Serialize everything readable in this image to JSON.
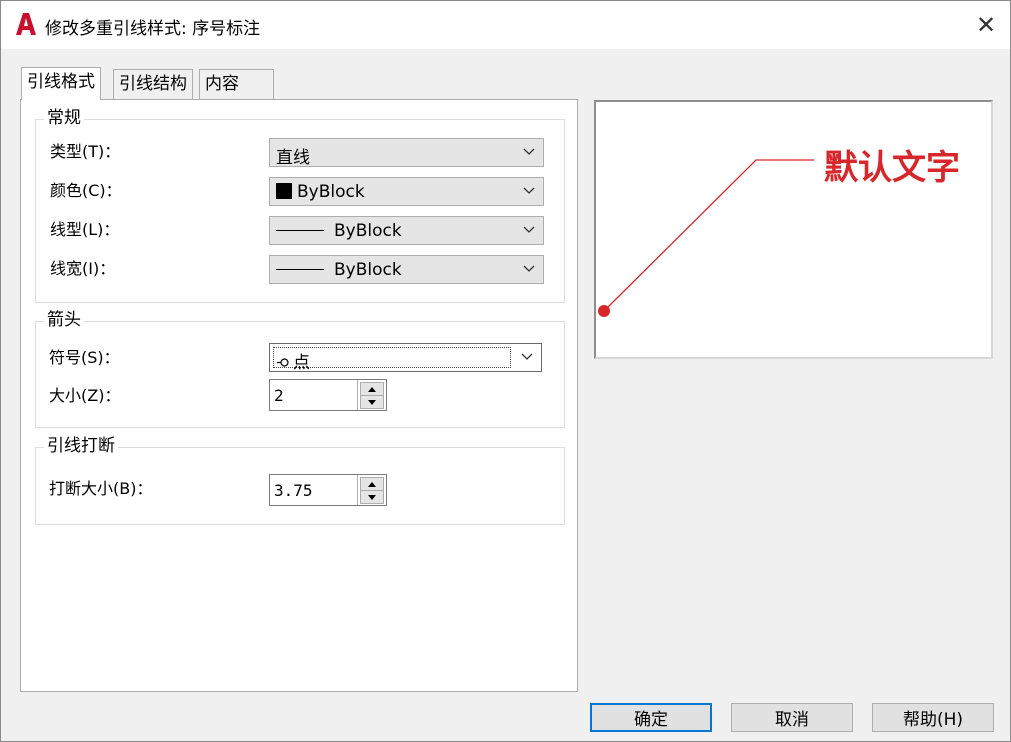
{
  "title": "修改多重引线样式: 序号标注",
  "colors": {
    "accent": "#0078d7",
    "preview_red": "#d9262b",
    "logo_red": "#c8102e"
  },
  "tabs": [
    {
      "label": "引线格式",
      "active": true
    },
    {
      "label": "引线结构",
      "active": false
    },
    {
      "label": "内容",
      "active": false
    }
  ],
  "general": {
    "title": "常规",
    "type_label": "类型(T)：",
    "type_value": "直线",
    "color_label": "颜色(C)：",
    "color_value": "ByBlock",
    "linetype_label": "线型(L)：",
    "linetype_value": "ByBlock",
    "lineweight_label": "线宽(I)：",
    "lineweight_value": "ByBlock"
  },
  "arrowhead": {
    "title": "箭头",
    "symbol_label": "符号(S)：",
    "symbol_value": "点",
    "size_label": "大小(Z)：",
    "size_value": "2"
  },
  "landing_break": {
    "title": "引线打断",
    "break_size_label": "打断大小(B)：",
    "break_size_value": "3.75"
  },
  "preview": {
    "text": "默认文字"
  },
  "buttons": {
    "ok": "确定",
    "cancel": "取消",
    "help": "帮助(H)"
  }
}
